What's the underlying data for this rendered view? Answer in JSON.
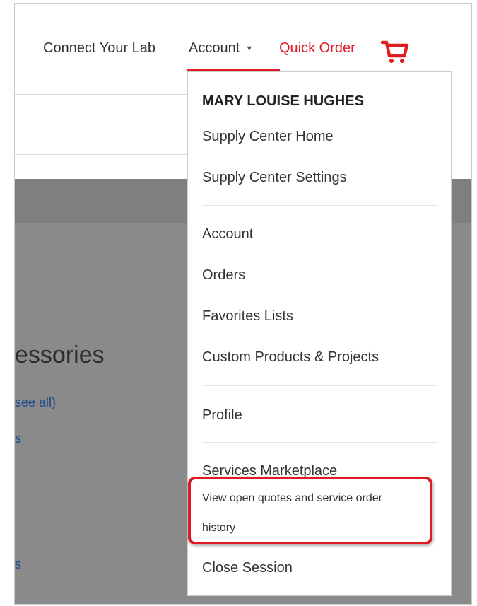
{
  "nav": {
    "connect_label": "Connect Your Lab",
    "account_label": "Account",
    "quick_order_label": "Quick Order",
    "accent_color": "#e31b23"
  },
  "background": {
    "heading_partial": "essories",
    "link_see_all": "see all)",
    "link_s1": "s",
    "link_s2": "s"
  },
  "menu": {
    "user_name": "MARY LOUISE HUGHES",
    "items": {
      "supply_center_home": "Supply Center Home",
      "supply_center_settings": "Supply Center Settings",
      "account": "Account",
      "orders": "Orders",
      "favorites_lists": "Favorites Lists",
      "custom_products": "Custom Products & Projects",
      "profile": "Profile",
      "services_marketplace": "Services Marketplace",
      "view_open_quotes_line1": "View open quotes and service order",
      "view_open_quotes_line2": "history",
      "close_session": "Close Session"
    }
  },
  "icons": {
    "cart": "cart-icon",
    "caret": "caret-down-icon"
  },
  "annotation": {
    "highlight_color": "#dc1b24"
  }
}
